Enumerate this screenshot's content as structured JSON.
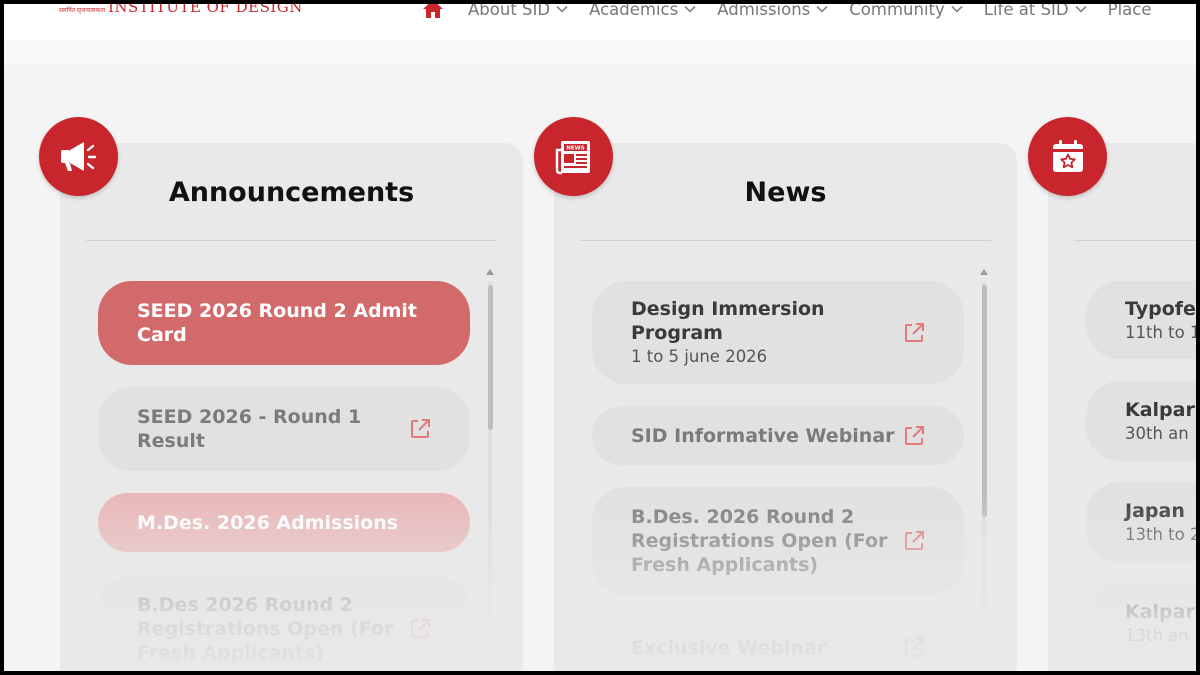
{
  "header": {
    "logo_tagline": "समर्पित सृजनात्मकता",
    "logo_text": "INSTITUTE OF DESIGN",
    "nav": [
      {
        "label": "About SID"
      },
      {
        "label": "Academics"
      },
      {
        "label": "Admissions"
      },
      {
        "label": "Community"
      },
      {
        "label": "Life at SID"
      },
      {
        "label": "Place"
      }
    ]
  },
  "columns": [
    {
      "title": "Announcements",
      "icon": "megaphone-icon",
      "items": [
        {
          "title": "SEED 2026 Round 2 Admit Card",
          "state": "active"
        },
        {
          "title": "SEED 2026 - Round 1 Result",
          "state": "normal"
        },
        {
          "title": "M.Des. 2026 Admissions",
          "state": "light"
        },
        {
          "title": "B.Des 2026 Round 2 Registrations Open (For Fresh Applicants)",
          "state": "normal"
        }
      ]
    },
    {
      "title": "News",
      "icon": "newspaper-icon",
      "items": [
        {
          "title": "Design Immersion Program",
          "subtitle": "1 to 5 june 2026",
          "state": "dark"
        },
        {
          "title": "SID Informative Webinar",
          "state": "normal"
        },
        {
          "title": "B.Des. 2026 Round 2 Registrations Open (For Fresh Applicants)",
          "state": "normal"
        },
        {
          "title": "Exclusive Webinar",
          "state": "normal"
        }
      ]
    },
    {
      "title": "",
      "icon": "calendar-star-icon",
      "items": [
        {
          "title": "Typofe",
          "subtitle": "11th to 1",
          "state": "dark"
        },
        {
          "title": "Kalpar",
          "subtitle": "30th an",
          "state": "dark"
        },
        {
          "title": "Japan",
          "subtitle": "13th to 2",
          "state": "dark"
        },
        {
          "title": "Kalpar",
          "subtitle": "13th an",
          "state": "dark"
        }
      ]
    }
  ],
  "colors": {
    "brand": "#c8262c",
    "active_item": "#d26a6c",
    "light_item": "#e9b7b8",
    "card": "#e9e9e9",
    "external_link_icon": "#e27a7c"
  }
}
